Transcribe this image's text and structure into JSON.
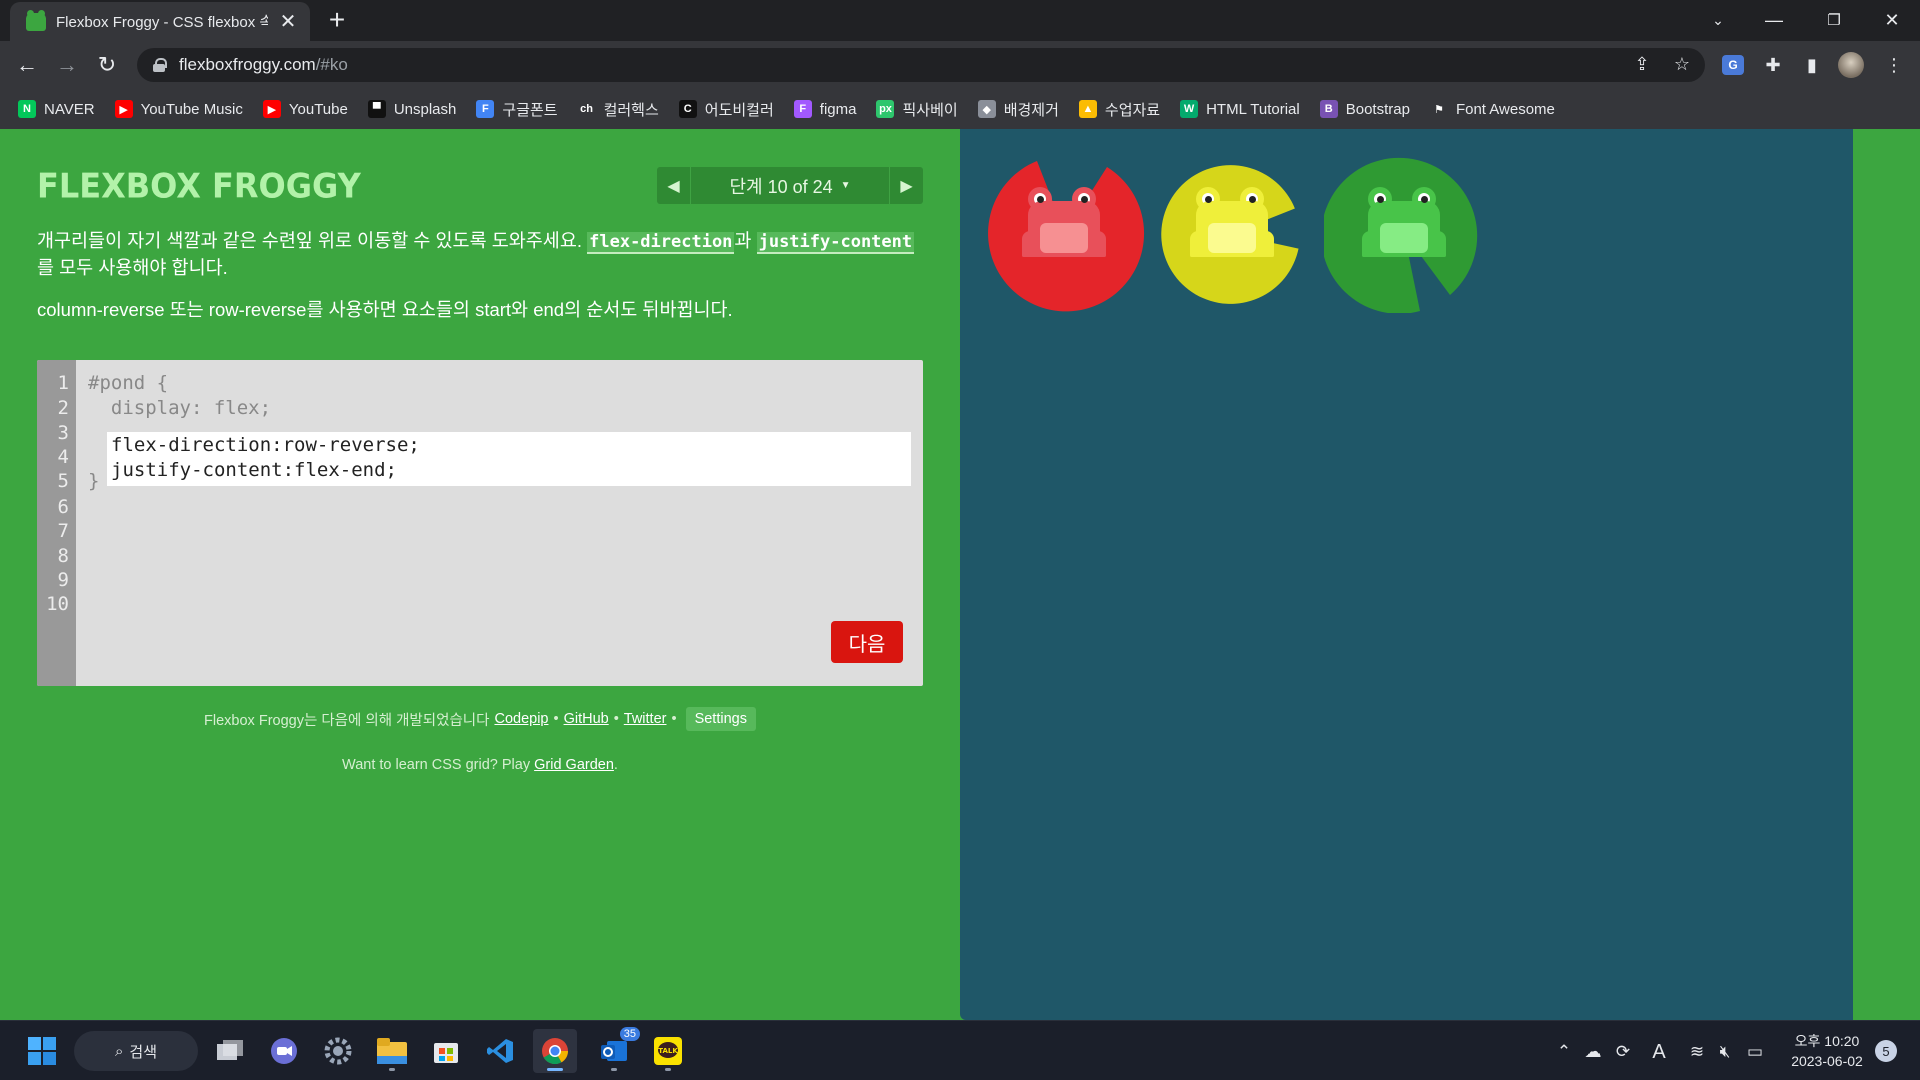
{
  "browser": {
    "tab": {
      "title": "Flexbox Froggy - CSS flexbox 속",
      "favicon": "frog-icon"
    },
    "url": {
      "host": "flexboxfroggy.com",
      "path": "/#ko"
    },
    "bookmarks": [
      {
        "label": "NAVER",
        "icon": "naver-icon",
        "color": "#03c75a",
        "glyph": "N"
      },
      {
        "label": "YouTube Music",
        "icon": "youtube-music-icon",
        "color": "#ff0000",
        "glyph": "▶"
      },
      {
        "label": "YouTube",
        "icon": "youtube-icon",
        "color": "#ff0000",
        "glyph": "▶"
      },
      {
        "label": "Unsplash",
        "icon": "unsplash-icon",
        "color": "#111111",
        "glyph": "▀"
      },
      {
        "label": "구글폰트",
        "icon": "google-fonts-icon",
        "color": "#4285f4",
        "glyph": "F"
      },
      {
        "label": "컬러헥스",
        "icon": "colorhex-icon",
        "color": "#35363a",
        "glyph": "ch"
      },
      {
        "label": "어도비컬러",
        "icon": "adobe-color-icon",
        "color": "#111111",
        "glyph": "C"
      },
      {
        "label": "figma",
        "icon": "figma-icon",
        "color": "#a259ff",
        "glyph": "F"
      },
      {
        "label": "픽사베이",
        "icon": "pixabay-icon",
        "color": "#2ec66d",
        "glyph": "px"
      },
      {
        "label": "배경제거",
        "icon": "remove-bg-icon",
        "color": "#8a8f99",
        "glyph": "◆"
      },
      {
        "label": "수업자료",
        "icon": "google-drive-icon",
        "color": "#fbbc04",
        "glyph": "▲"
      },
      {
        "label": "HTML Tutorial",
        "icon": "w3schools-icon",
        "color": "#04aa6d",
        "glyph": "W"
      },
      {
        "label": "Bootstrap",
        "icon": "bootstrap-icon",
        "color": "#7952b3",
        "glyph": "B"
      },
      {
        "label": "Font Awesome",
        "icon": "font-awesome-icon",
        "color": "#35363a",
        "glyph": "⚑"
      }
    ]
  },
  "game": {
    "logo": "FLEXBOX FROGGY",
    "level": {
      "label": "단계 10 of 24",
      "current": 10,
      "total": 24
    },
    "instructions": {
      "p1_before": "개구리들이 자기 색깔과 같은 수련잎 위로 이동할 수 있도록 도와주세요. ",
      "p1_code1": "flex-direction",
      "p1_mid": "과 ",
      "p1_code2": "justify-content",
      "p1_after": "를 모두 사용해야 합니다.",
      "p2": "column-reverse 또는 row-reverse를 사용하면 요소들의 start와 end의 순서도 뒤바뀝니다."
    },
    "editor": {
      "line_numbers": [
        "1",
        "2",
        "3",
        "4",
        "5",
        "6",
        "7",
        "8",
        "9",
        "10"
      ],
      "line1": "#pond {",
      "line2": "  display: flex;",
      "answer_line1": "flex-direction:row-reverse;",
      "answer_line2": "justify-content:flex-end;",
      "line5": "}",
      "next_label": "다음"
    },
    "credits": {
      "text": "Flexbox Froggy는 다음에 의해 개발되었습니다",
      "codepip": "Codepip",
      "github": "GitHub",
      "twitter": "Twitter",
      "settings": "Settings",
      "bullet": "•"
    },
    "grid_promo": {
      "text": "Want to learn CSS grid? Play ",
      "link": "Grid Garden",
      "end": "."
    },
    "pads": [
      {
        "color": "red",
        "hex": "#e4252a"
      },
      {
        "color": "yellow",
        "hex": "#d6d61a"
      },
      {
        "color": "green",
        "hex": "#2f9a33"
      }
    ],
    "frogs": [
      {
        "color": "red",
        "hex": "#e8505a"
      },
      {
        "color": "yellow",
        "hex": "#efef3a"
      },
      {
        "color": "green",
        "hex": "#48c449"
      }
    ]
  },
  "taskbar": {
    "search_label": "검색",
    "apps": [
      "task-view-icon",
      "zoom-icon",
      "settings-icon",
      "file-explorer-icon",
      "microsoft-store-icon",
      "vscode-icon",
      "chrome-icon",
      "outlook-icon",
      "kakaotalk-icon"
    ],
    "outlook_badge": "35",
    "ime_indicator": "A",
    "clock_time": "오후 10:20",
    "clock_date": "2023-06-02",
    "notification_count": "5"
  }
}
